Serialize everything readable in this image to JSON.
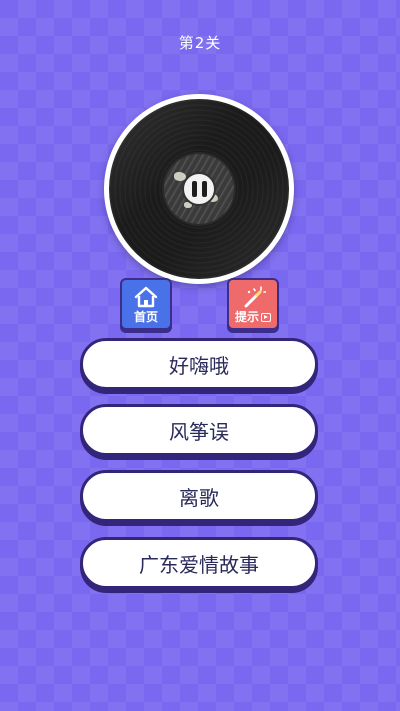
{
  "level": {
    "title": "第2关"
  },
  "player": {
    "state_icon": "pause-icon"
  },
  "toolbar": {
    "home_label": "首页",
    "home_icon": "home-icon",
    "hint_label": "提示",
    "hint_icon": "magic-wand-icon",
    "hint_badge_icon": "video-icon",
    "home_color": "#4a72e8",
    "hint_color": "#ef6b6b"
  },
  "answers": [
    {
      "label": "好嗨哦"
    },
    {
      "label": "风筝误"
    },
    {
      "label": "离歌"
    },
    {
      "label": "广东爱情故事"
    }
  ],
  "colors": {
    "background": "#7a68f0",
    "border": "#33267a"
  }
}
